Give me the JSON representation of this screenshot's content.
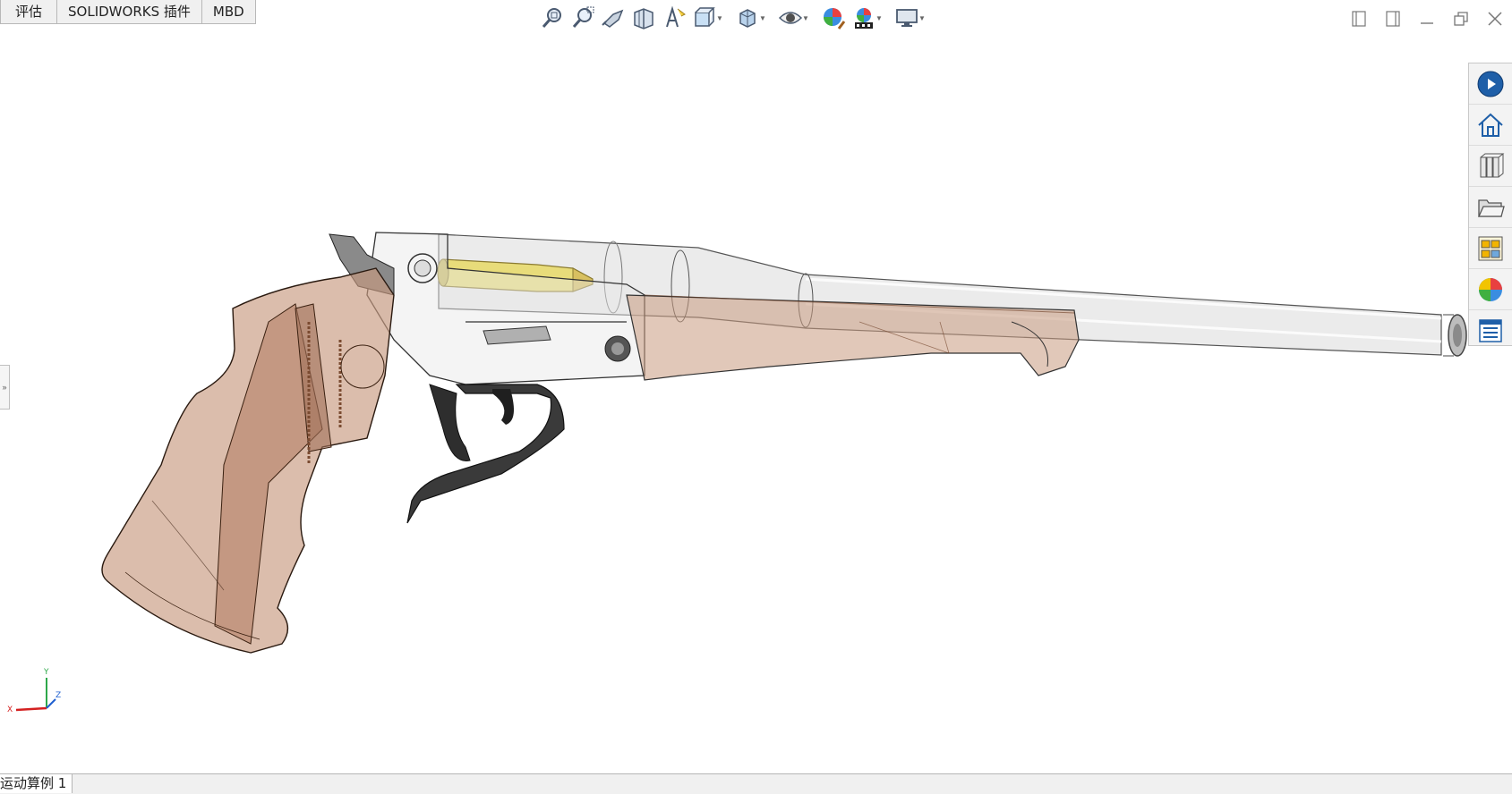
{
  "command_tabs": [
    "评估",
    "SOLIDWORKS 插件",
    "MBD"
  ],
  "hud_toolbar": {
    "buttons": [
      {
        "icon": "zoom-to-fit-icon",
        "dropdown": false
      },
      {
        "icon": "zoom-to-area-icon",
        "dropdown": false
      },
      {
        "icon": "previous-view-icon",
        "dropdown": false
      },
      {
        "icon": "section-view-icon",
        "dropdown": false
      },
      {
        "icon": "dynamic-annotation-views-icon",
        "dropdown": false
      },
      {
        "icon": "view-orientation-icon",
        "dropdown": true
      },
      {
        "icon": "display-style-icon",
        "dropdown": true
      },
      {
        "icon": "hide-show-items-icon",
        "dropdown": true
      },
      {
        "icon": "edit-appearance-icon",
        "dropdown": false
      },
      {
        "icon": "apply-scene-icon",
        "dropdown": true
      },
      {
        "icon": "view-settings-icon",
        "dropdown": true
      }
    ]
  },
  "window_controls": [
    "tile-left-icon",
    "tile-right-icon",
    "minimize-icon",
    "restore-icon",
    "close-icon"
  ],
  "task_pane": {
    "items": [
      "solidworks-resources-icon",
      "home-icon",
      "design-library-icon",
      "file-explorer-icon",
      "view-palette-icon",
      "appearances-scenes-icon",
      "custom-properties-icon"
    ]
  },
  "triad": {
    "x_label": "X",
    "y_label": "Y",
    "z_label": "Z"
  },
  "left_grip_glyph": "»",
  "bottom_tab": {
    "label": "运动算例 1"
  },
  "colors": {
    "accent": "#1f5fa8",
    "grip_wood": "#c89a80",
    "barrel_steel": "#c8c8c8",
    "bullet_brass": "#e8dc7a",
    "frame_dark": "#3a3a3a"
  }
}
